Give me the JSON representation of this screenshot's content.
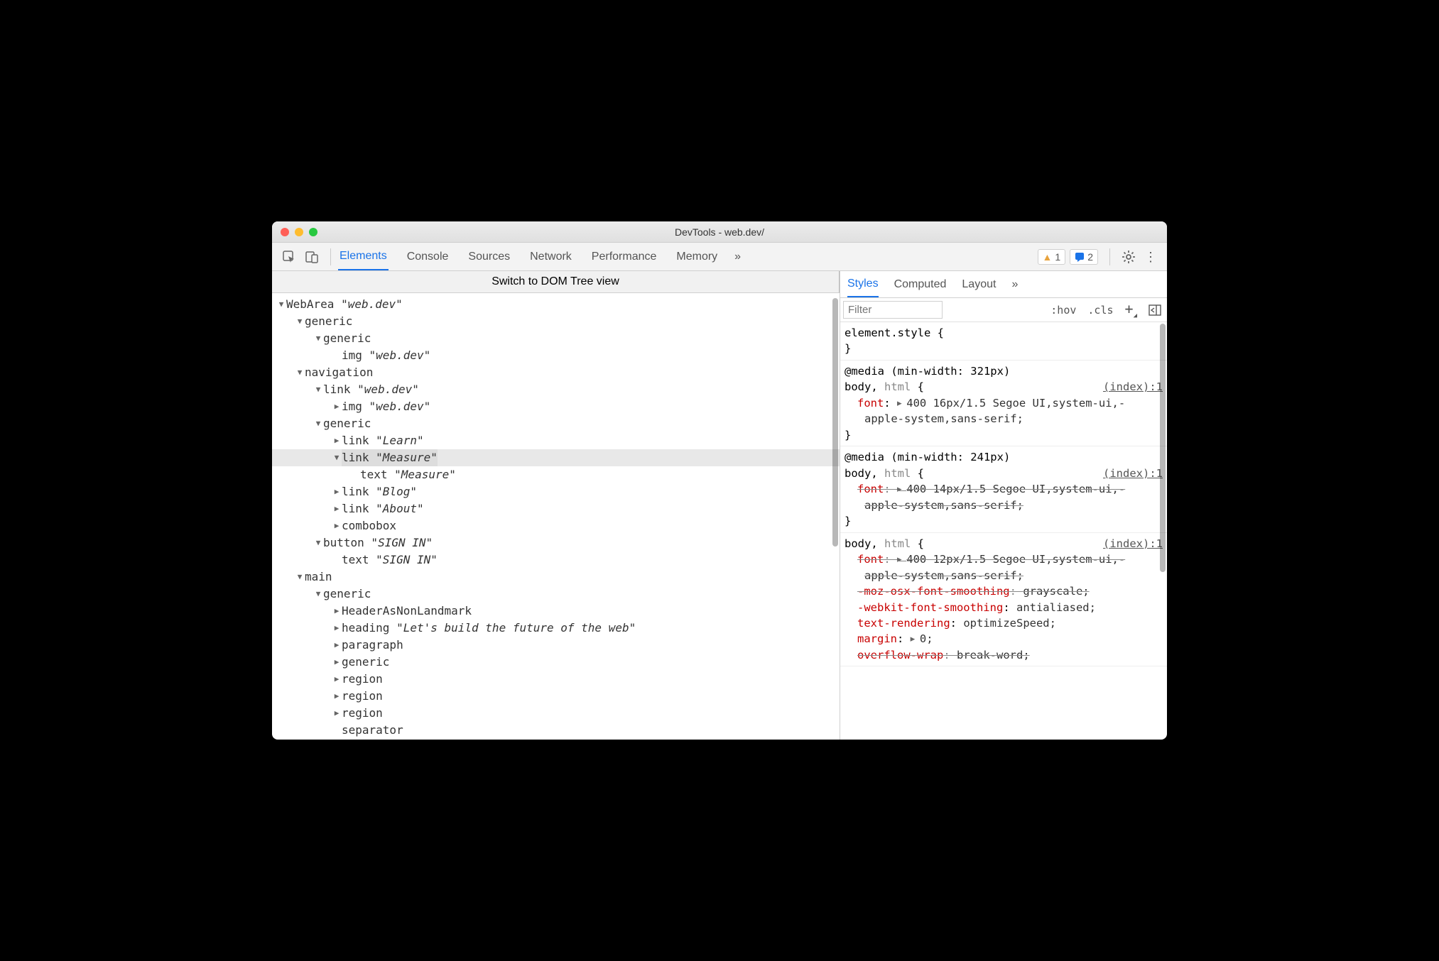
{
  "window": {
    "title": "DevTools - web.dev/"
  },
  "toolbar": {
    "tabs": [
      "Elements",
      "Console",
      "Sources",
      "Network",
      "Performance",
      "Memory"
    ],
    "active_tab": 0,
    "overflow": "»",
    "warning_count": "1",
    "info_count": "2"
  },
  "dom_switch": "Switch to DOM Tree view",
  "tree": [
    {
      "depth": 0,
      "arrow": "open",
      "role": "WebArea",
      "name": "web.dev"
    },
    {
      "depth": 1,
      "arrow": "open",
      "role": "generic"
    },
    {
      "depth": 2,
      "arrow": "open",
      "role": "generic"
    },
    {
      "depth": 3,
      "arrow": "none",
      "role": "img",
      "name": "web.dev"
    },
    {
      "depth": 1,
      "arrow": "open",
      "role": "navigation"
    },
    {
      "depth": 2,
      "arrow": "open",
      "role": "link",
      "name": "web.dev"
    },
    {
      "depth": 3,
      "arrow": "closed",
      "role": "img",
      "name": "web.dev"
    },
    {
      "depth": 2,
      "arrow": "open",
      "role": "generic"
    },
    {
      "depth": 3,
      "arrow": "closed",
      "role": "link",
      "name": "Learn"
    },
    {
      "depth": 3,
      "arrow": "open",
      "role": "link",
      "name": "Measure",
      "selected": true
    },
    {
      "depth": 4,
      "arrow": "none",
      "role": "text",
      "name": "Measure"
    },
    {
      "depth": 3,
      "arrow": "closed",
      "role": "link",
      "name": "Blog"
    },
    {
      "depth": 3,
      "arrow": "closed",
      "role": "link",
      "name": "About"
    },
    {
      "depth": 3,
      "arrow": "closed",
      "role": "combobox"
    },
    {
      "depth": 2,
      "arrow": "open",
      "role": "button",
      "name": "SIGN IN"
    },
    {
      "depth": 3,
      "arrow": "none",
      "role": "text",
      "name": "SIGN IN"
    },
    {
      "depth": 1,
      "arrow": "open",
      "role": "main"
    },
    {
      "depth": 2,
      "arrow": "open",
      "role": "generic"
    },
    {
      "depth": 3,
      "arrow": "closed",
      "role": "HeaderAsNonLandmark"
    },
    {
      "depth": 3,
      "arrow": "closed",
      "role": "heading",
      "name": "Let's build the future of the web"
    },
    {
      "depth": 3,
      "arrow": "closed",
      "role": "paragraph"
    },
    {
      "depth": 3,
      "arrow": "closed",
      "role": "generic"
    },
    {
      "depth": 3,
      "arrow": "closed",
      "role": "region"
    },
    {
      "depth": 3,
      "arrow": "closed",
      "role": "region"
    },
    {
      "depth": 3,
      "arrow": "closed",
      "role": "region"
    },
    {
      "depth": 3,
      "arrow": "none",
      "role": "separator"
    }
  ],
  "side": {
    "tabs": [
      "Styles",
      "Computed",
      "Layout"
    ],
    "active_tab": 0,
    "overflow": "»",
    "filter_placeholder": "Filter",
    "hov": ":hov",
    "cls": ".cls"
  },
  "rules": [
    {
      "media": null,
      "selector_raw": "element.style {",
      "source": null,
      "props": [],
      "close": "}"
    },
    {
      "media": "@media (min-width: 321px)",
      "selector": "body, html",
      "source": "(index):1",
      "props": [
        {
          "name": "font",
          "value": "400 16px/1.5 Segoe UI,system-ui,-apple-system,sans-serif;",
          "strike": false,
          "expand": true
        }
      ],
      "close": "}"
    },
    {
      "media": "@media (min-width: 241px)",
      "selector": "body, html",
      "source": "(index):1",
      "props": [
        {
          "name": "font",
          "value": "400 14px/1.5 Segoe UI,system-ui,-apple-system,sans-serif;",
          "strike": true,
          "expand": true
        }
      ],
      "close": "}"
    },
    {
      "media": null,
      "selector": "body, html",
      "source": "(index):1",
      "props": [
        {
          "name": "font",
          "value": "400 12px/1.5 Segoe UI,system-ui,-apple-system,sans-serif;",
          "strike": true,
          "expand": true
        },
        {
          "name": "-moz-osx-font-smoothing",
          "value": "grayscale;",
          "strike": true
        },
        {
          "name": "-webkit-font-smoothing",
          "value": "antialiased;",
          "strike": false
        },
        {
          "name": "text-rendering",
          "value": "optimizeSpeed;",
          "strike": false
        },
        {
          "name": "margin",
          "value": "0;",
          "strike": false,
          "expand": true
        },
        {
          "name": "overflow-wrap",
          "value": "break-word;",
          "strike": true
        }
      ],
      "close": null
    }
  ]
}
